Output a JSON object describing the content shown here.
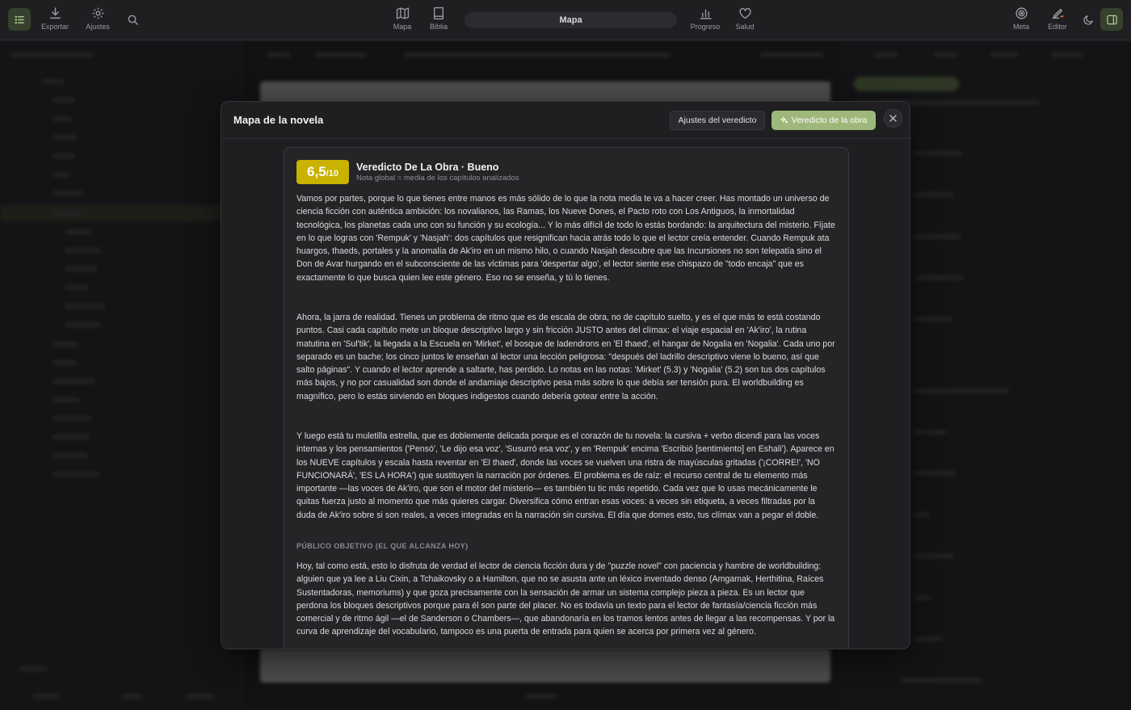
{
  "toolbar": {
    "export_label": "Exportar",
    "settings_label": "Ajustes",
    "map_label": "Mapa",
    "bible_label": "Biblia",
    "center_title": "Mapa",
    "progress_label": "Progreso",
    "health_label": "Salud",
    "goal_label": "Meta",
    "editor_label": "Editor"
  },
  "modal": {
    "title": "Mapa de la novela",
    "settings_button": "Ajustes del veredicto",
    "verdict_button": "Veredicto de la obra",
    "verdict_button_icon": "sparkle-icon",
    "close_icon": "close-icon"
  },
  "verdict": {
    "score": "6,5",
    "score_scale": "/10",
    "score_color": "#c9b200",
    "title": "Veredicto De La Obra · Bueno",
    "subtitle": "Nota global = media de los capítulos analizados",
    "paragraphs": [
      "Vamos por partes, porque lo que tienes entre manos es más sólido de lo que la nota media te va a hacer creer. Has montado un universo de ciencia ficción con auténtica ambición: los novalianos, las Ramas, los Nueve Dones, el Pacto roto con Los Antiguos, la inmortalidad tecnológica, los planetas cada uno con su función y su ecología... Y lo más difícil de todo lo estás bordando: la arquitectura del misterio. Fíjate en lo que logras con 'Rempuk' y 'Nasjah': dos capítulos que resignifican hacia atrás todo lo que el lector creía entender. Cuando Rempuk ata huargos, thaeds, portales y la anomalía de Ak'iro en un mismo hilo, o cuando Nasjah descubre que las Incursiones no son telepatía sino el Don de Avar hurgando en el subconsciente de las víctimas para 'despertar algo', el lector siente ese chispazo de \"todo encaja\" que es exactamente lo que busca quien lee este género. Eso no se enseña, y tú lo tienes.",
      "Ahora, la jarra de realidad. Tienes un problema de ritmo que es de escala de obra, no de capítulo suelto, y es el que más te está costando puntos. Casi cada capítulo mete un bloque descriptivo largo y sin fricción JUSTO antes del clímax: el viaje espacial en 'Ak'iro', la rutina matutina en 'Sul'tik', la llegada a la Escuela en 'Mirket', el bosque de ladendrons en 'El thaed', el hangar de Nogalia en 'Nogalia'. Cada uno por separado es un bache; los cinco juntos le enseñan al lector una lección peligrosa: \"después del ladrillo descriptivo viene lo bueno, así que salto páginas\". Y cuando el lector aprende a saltarte, has perdido. Lo notas en las notas: 'Mirket' (5.3) y 'Nogalia' (5.2) son tus dos capítulos más bajos, y no por casualidad son donde el andamiaje descriptivo pesa más sobre lo que debía ser tensión pura. El worldbuilding es magnífico, pero lo estás sirviendo en bloques indigestos cuando debería gotear entre la acción.",
      "Y luego está tu muletilla estrella, que es doblemente delicada porque es el corazón de tu novela: la cursiva + verbo dicendi para las voces internas y los pensamientos ('Pensó', 'Le dijo esa voz', 'Susurró esa voz', y en 'Rempuk' encima 'Escribió [sentimiento] en Eshali'). Aparece en los NUEVE capítulos y escala hasta reventar en 'El thaed', donde las voces se vuelven una ristra de mayúsculas gritadas ('¡CORRE!', 'NO FUNCIONARÁ', 'ES LA HORA') que sustituyen la narración por órdenes. El problema es de raíz: el recurso central de tu elemento más importante —las voces de Ak'iro, que son el motor del misterio— es también tu tic más repetido. Cada vez que lo usas mecánicamente le quitas fuerza justo al momento que más quieres cargar. Diversifica cómo entran esas voces: a veces sin etiqueta, a veces filtradas por la duda de Ak'iro sobre si son reales, a veces integradas en la narración sin cursiva. El día que domes esto, tus clímax van a pegar el doble."
    ],
    "audience_heading": "PÚBLICO OBJETIVO (EL QUE ALCANZA HOY)",
    "audience_text": "Hoy, tal como está, esto lo disfruta de verdad el lector de ciencia ficción dura y de \"puzzle novel\" con paciencia y hambre de worldbuilding: alguien que ya lee a Liu Cixin, a Tchaikovsky o a Hamilton, que no se asusta ante un léxico inventado denso (Amgamak, Herthitina, Raíces Sustentadoras, memoriums) y que goza precisamente con la sensación de armar un sistema complejo pieza a pieza. Es un lector que perdona los bloques descriptivos porque para él son parte del placer. No es todavía un texto para el lector de fantasía/ciencia ficción más comercial y de ritmo ágil —el de Sanderson o Chambers—, que abandonaría en los tramos lentos antes de llegar a las recompensas. Y por la curva de aprendizaje del vocabulario, tampoco es una puerta de entrada para quien se acerca por primera vez al género."
  },
  "colors": {
    "accent_green": "#9eb87b",
    "background": "#1b1b1e"
  }
}
